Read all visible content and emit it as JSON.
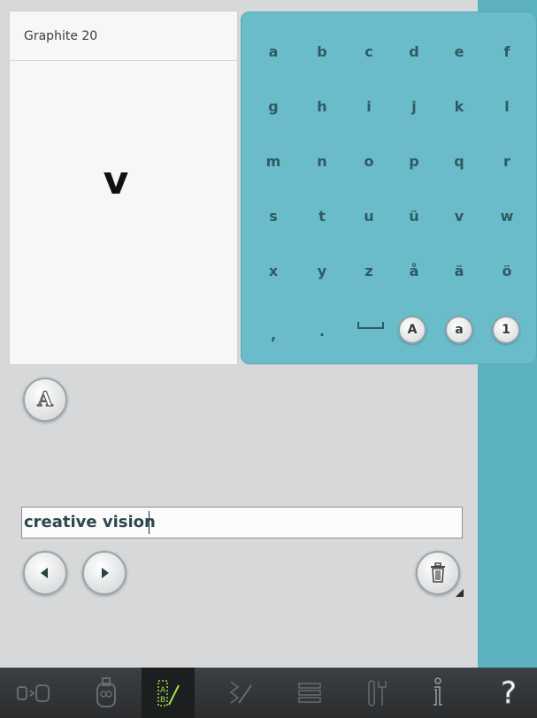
{
  "preview": {
    "font_name": "Graphite 20",
    "glyph": "v"
  },
  "keyboard": {
    "rows": [
      [
        "a",
        "b",
        "c",
        "d",
        "e",
        "f"
      ],
      [
        "g",
        "h",
        "i",
        "j",
        "k",
        "l"
      ],
      [
        "m",
        "n",
        "o",
        "p",
        "q",
        "r"
      ],
      [
        "s",
        "t",
        "u",
        "ü",
        "v",
        "w"
      ],
      [
        "x",
        "y",
        "z",
        "å",
        "ä",
        "ö"
      ]
    ],
    "last_row": {
      "comma": ",",
      "period": ".",
      "uppercase": "A",
      "lowercase": "a",
      "numbers": "1"
    }
  },
  "font_button_label": "A",
  "text_field": {
    "value": "creative vision"
  },
  "colors": {
    "keyboard_bg": "#6bbccb",
    "accent_green": "#9be04a"
  },
  "bottom_bar": {
    "items": [
      {
        "name": "tab-embroidery-edit",
        "icon": "embroidery-edit-icon"
      },
      {
        "name": "tab-hoop-selection",
        "icon": "hoop-selection-icon"
      },
      {
        "name": "tab-text-edit",
        "icon": "text-edit-icon",
        "active": true
      },
      {
        "name": "tab-stitch-menu",
        "icon": "stitch-menu-icon"
      },
      {
        "name": "tab-file-manager",
        "icon": "file-manager-icon"
      },
      {
        "name": "tab-settings",
        "icon": "tools-icon"
      },
      {
        "name": "tab-info",
        "icon": "info-icon"
      },
      {
        "name": "tab-help",
        "icon": "help-icon",
        "label": "?"
      }
    ]
  }
}
